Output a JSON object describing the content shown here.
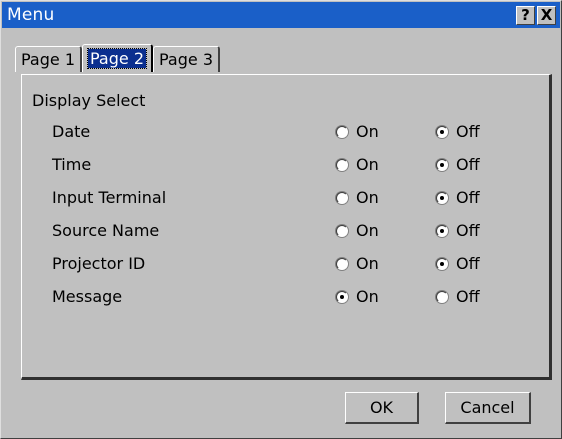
{
  "window": {
    "title": "Menu",
    "help_label": "?",
    "close_label": "X"
  },
  "tabs": [
    {
      "label": "Page 1",
      "active": false
    },
    {
      "label": "Page 2",
      "active": true
    },
    {
      "label": "Page 3",
      "active": false
    }
  ],
  "section": {
    "title": "Display Select"
  },
  "options": {
    "on_label": "On",
    "off_label": "Off"
  },
  "rows": [
    {
      "label": "Date",
      "selected": "off"
    },
    {
      "label": "Time",
      "selected": "off"
    },
    {
      "label": "Input Terminal",
      "selected": "off"
    },
    {
      "label": "Source Name",
      "selected": "off"
    },
    {
      "label": "Projector ID",
      "selected": "off"
    },
    {
      "label": "Message",
      "selected": "on"
    }
  ],
  "buttons": {
    "ok_label": "OK",
    "cancel_label": "Cancel"
  },
  "colors": {
    "titlebar": "#1a5fc8",
    "face": "#c0c0c0",
    "active_tab_highlight": "#0b2f8f"
  }
}
